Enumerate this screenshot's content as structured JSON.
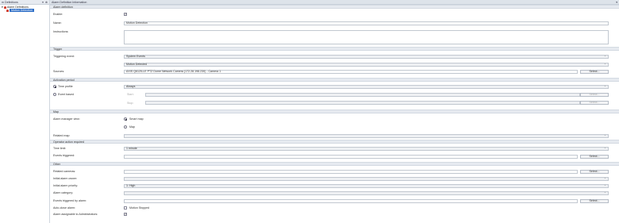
{
  "left_panel": {
    "title": "m Definitions",
    "tree": {
      "root": "Alarm Definitions",
      "child": "Motion Detection"
    }
  },
  "main": {
    "title": "Alarm Definition Information",
    "sections": {
      "alarm_definition": "Alarm definition",
      "trigger": "Trigger",
      "activation": "Activation period",
      "map": "Map",
      "operator": "Operator action required",
      "other": "Other"
    },
    "labels": {
      "enable": "Enable:",
      "name": "Name:",
      "instructions": "Instructions:",
      "triggering_event": "Triggering event:",
      "sources": "Sources:",
      "time_profile": "Time profile",
      "event_based": "Event based",
      "start": "Start:",
      "stop": "Stop:",
      "alarm_manager_view": "Alarm manager view:",
      "smart_map": "Smart map",
      "map_opt": "Map",
      "related_map": "Related map:",
      "time_limit": "Time limit:",
      "events_triggered": "Events triggered:",
      "related_cameras": "Related cameras:",
      "initial_owner": "Initial alarm owner:",
      "initial_priority": "Initial alarm priority:",
      "alarm_category": "Alarm category:",
      "events_triggered_by_alarm": "Events triggered by alarm:",
      "auto_close": "Auto-close alarm:",
      "alarm_assignable": "Alarm assignable to Administrators:",
      "motion_stopped": "Motion Stopped"
    },
    "values": {
      "name": "Motion Detection",
      "triggering_event_1": "System Events",
      "triggering_event_2": "Motion Detected",
      "sources": "AXIS Q6125-LE PTZ Dome Network Camera (172.28.198.230) - Camera 1",
      "time_profile": "Always",
      "time_limit": "1 minute",
      "initial_priority": "1: High"
    },
    "buttons": {
      "select": "Select..."
    }
  }
}
